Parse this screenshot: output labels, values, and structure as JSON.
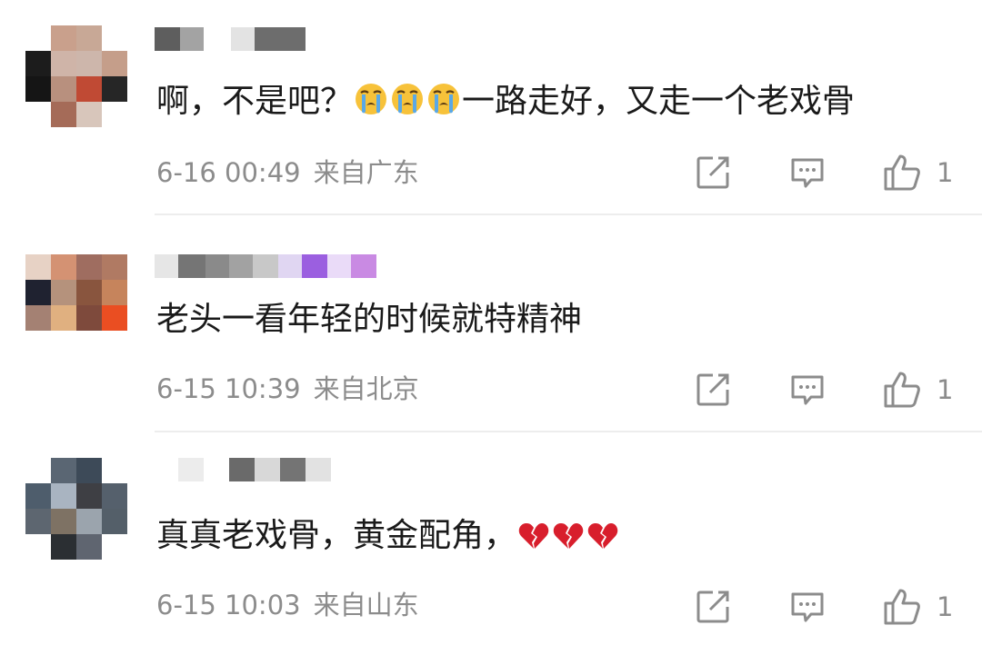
{
  "comments": [
    {
      "text_before": "啊，不是吧？",
      "emojis": [
        "crying-face",
        "crying-face",
        "crying-face"
      ],
      "text_after": "一路走好，又走一个老戏骨",
      "date": "6-16 00:49",
      "location": "来自广东",
      "likes": "1",
      "avatar_colors": [
        "#ffffff",
        "#c9a08c",
        "#c8a896",
        "#ffffff",
        "#1c1c1c",
        "#cfb4a8",
        "#cdb6ab",
        "#c59e8a",
        "#151515",
        "#b8907e",
        "#c04a34",
        "#262626",
        "#ffffff",
        "#a56b58",
        "#d8c6bb",
        "#ffffff"
      ]
    },
    {
      "text_before": "老头一看年轻的时候就特精神",
      "emojis": [],
      "text_after": "",
      "date": "6-15 10:39",
      "location": "来自北京",
      "likes": "1",
      "avatar_colors": [
        "#e7d2c5",
        "#d49273",
        "#9f6d60",
        "#b07a63",
        "#1f2230",
        "#b5927c",
        "#89553e",
        "#c6845c",
        "#a48173",
        "#e0b080",
        "#7e4a3c",
        "#ea4e22",
        "#ffffff",
        "#ffffff",
        "#ffffff",
        "#ffffff"
      ]
    },
    {
      "text_before": "真真老戏骨，黄金配角，",
      "emojis": [
        "broken-heart",
        "broken-heart",
        "broken-heart"
      ],
      "text_after": "",
      "date": "6-15 10:03",
      "location": "来自山东",
      "likes": "1",
      "avatar_colors": [
        "#ffffff",
        "#5a6673",
        "#3d4a58",
        "#ffffff",
        "#4e5d6c",
        "#a9b4c1",
        "#3e3f44",
        "#55606c",
        "#5d6670",
        "#7e7264",
        "#9ba4ad",
        "#545f69",
        "#ffffff",
        "#2b2f33",
        "#5f6570",
        "#ffffff"
      ]
    }
  ],
  "colors": {
    "text": "#1a1a1a",
    "meta": "#8c8c8c",
    "divider": "#ededed",
    "icon": "#8c8c8c"
  },
  "icons": [
    "repost-icon",
    "comment-icon",
    "like-icon"
  ]
}
